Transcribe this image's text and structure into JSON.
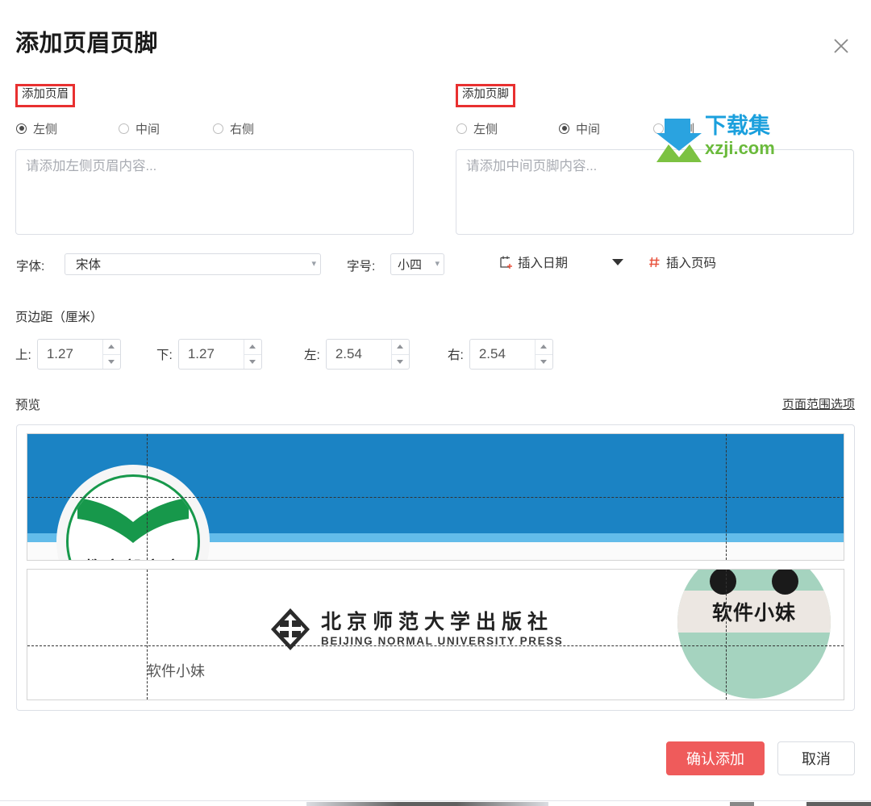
{
  "dialog": {
    "title": "添加页眉页脚",
    "close_icon": "close-icon"
  },
  "header_section": {
    "label": "添加页眉",
    "position_options": [
      {
        "label": "左侧",
        "selected": true
      },
      {
        "label": "中间",
        "selected": false
      },
      {
        "label": "右侧",
        "selected": false
      }
    ],
    "content_placeholder": "请添加左侧页眉内容...",
    "content_value": "",
    "font_label": "字体:",
    "font_value": "宋体",
    "size_label": "字号:",
    "size_value": "小四"
  },
  "footer_section": {
    "label": "添加页脚",
    "position_options": [
      {
        "label": "左侧",
        "selected": false
      },
      {
        "label": "中间",
        "selected": true
      },
      {
        "label": "右侧",
        "selected": false
      }
    ],
    "content_placeholder": "请添加中间页脚内容...",
    "content_value": "",
    "insert_date_label": "插入日期",
    "insert_date_icon": "calendar-plus-icon",
    "insert_date_dropdown_icon": "chevron-down-icon",
    "insert_page_label": "插入页码",
    "insert_page_icon": "page-number-icon"
  },
  "margins": {
    "title": "页边距（厘米）",
    "fields": [
      {
        "label": "上:",
        "value": "1.27"
      },
      {
        "label": "下:",
        "value": "1.27"
      },
      {
        "label": "左:",
        "value": "2.54"
      },
      {
        "label": "右:",
        "value": "2.54"
      }
    ]
  },
  "preview": {
    "label": "预览",
    "page_range_link": "页面范围选项",
    "page_top": {
      "seal_text": "教育部审定"
    },
    "page_bottom": {
      "publisher_cn": "北京师范大学出版社",
      "publisher_en": "BEIJING NORMAL UNIVERSITY PRESS",
      "mascot_name": "软件小妹",
      "footer_text": "软件小妹"
    }
  },
  "actions": {
    "confirm_label": "确认添加",
    "cancel_label": "取消"
  },
  "watermark": {
    "text_cn": "下载集",
    "text_en": "xzji.com"
  },
  "colors": {
    "accent_red": "#e83030",
    "confirm_button": "#ef5b5b",
    "banner_blue": "#1b83c4",
    "banner_blue_light": "#63bcea",
    "seal_green": "#17984b",
    "mascot_green": "#a5d3bf",
    "watermark_blue": "#1ba0dd",
    "watermark_green": "#6aba3b"
  }
}
